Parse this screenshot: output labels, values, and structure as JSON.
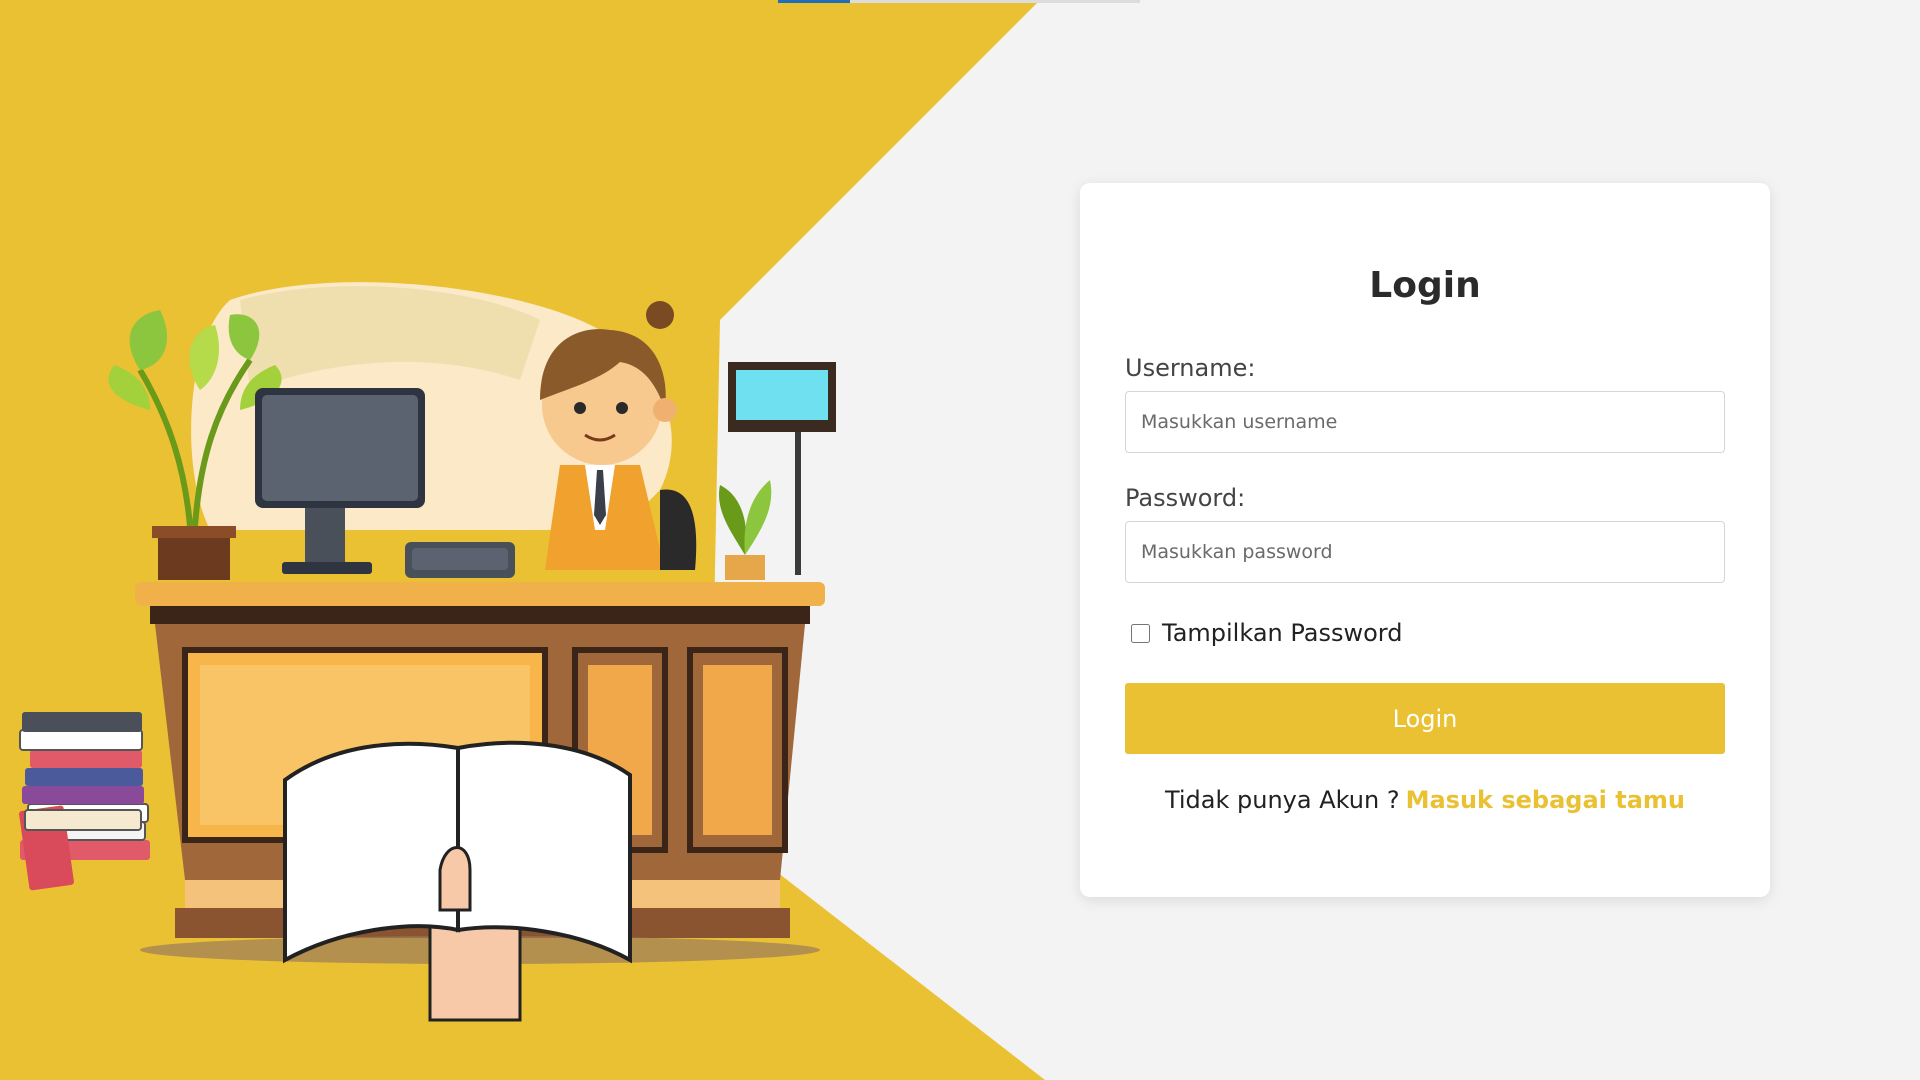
{
  "colors": {
    "accent": "#ebc134",
    "background": "#f3f3f3",
    "card": "#ffffff",
    "progress": "#1f6fb5"
  },
  "progress": {
    "fraction": 0.2
  },
  "login_card": {
    "title": "Login",
    "username_label": "Username:",
    "username_placeholder": "Masukkan username",
    "username_value": "",
    "password_label": "Password:",
    "password_placeholder": "Masukkan password",
    "password_value": "",
    "show_password_label": "Tampilkan Password",
    "show_password_checked": false,
    "submit_label": "Login",
    "no_account_text": "Tidak punya Akun ?",
    "guest_link_label": "Masuk sebagai tamu"
  },
  "illustration": {
    "icon": "librarian-desk-illustration"
  }
}
